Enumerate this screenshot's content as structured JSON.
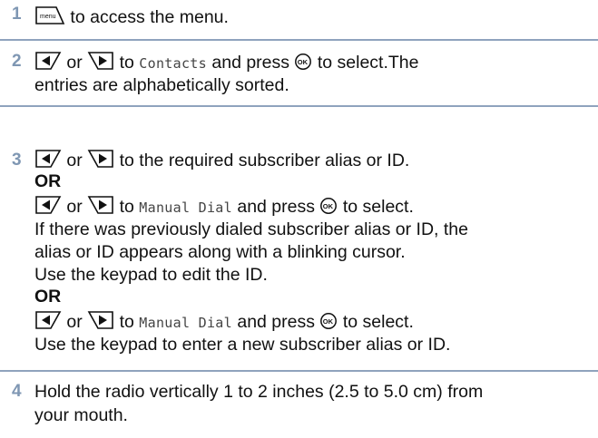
{
  "colors": {
    "step_number": "#7f97b3",
    "divider": "#8fa3bd"
  },
  "icons": {
    "menu": "menu-key-icon",
    "left": "left-navigation-key-icon",
    "right": "right-navigation-key-icon",
    "ok": "ok-key-icon"
  },
  "step1": {
    "number": "1",
    "menu_key_label": "menu",
    "text": "to access the menu."
  },
  "step2": {
    "number": "2",
    "or": "or",
    "to": "to",
    "item": "Contacts",
    "and_press": "and press",
    "to_select": "to select.The",
    "line2": "entries are alphabetically sorted."
  },
  "step3": {
    "number": "3",
    "or": "or",
    "line1_text": "to the required subscriber alias or ID.",
    "or_heading_1": "OR",
    "to": "to",
    "manual_dial": "Manual Dial",
    "and_press": "and press",
    "to_select": "to select.",
    "line4": "If there was previously dialed subscriber alias or ID, the",
    "line5": "alias or ID appears along with a blinking cursor.",
    "line6": "Use the keypad to edit the ID.",
    "or_heading_2": "OR",
    "line9": "Use the keypad to enter a new subscriber alias or ID."
  },
  "step4": {
    "number": "4",
    "line1": "Hold the radio vertically 1 to 2 inches (2.5 to 5.0 cm) from",
    "line2": "your mouth."
  }
}
